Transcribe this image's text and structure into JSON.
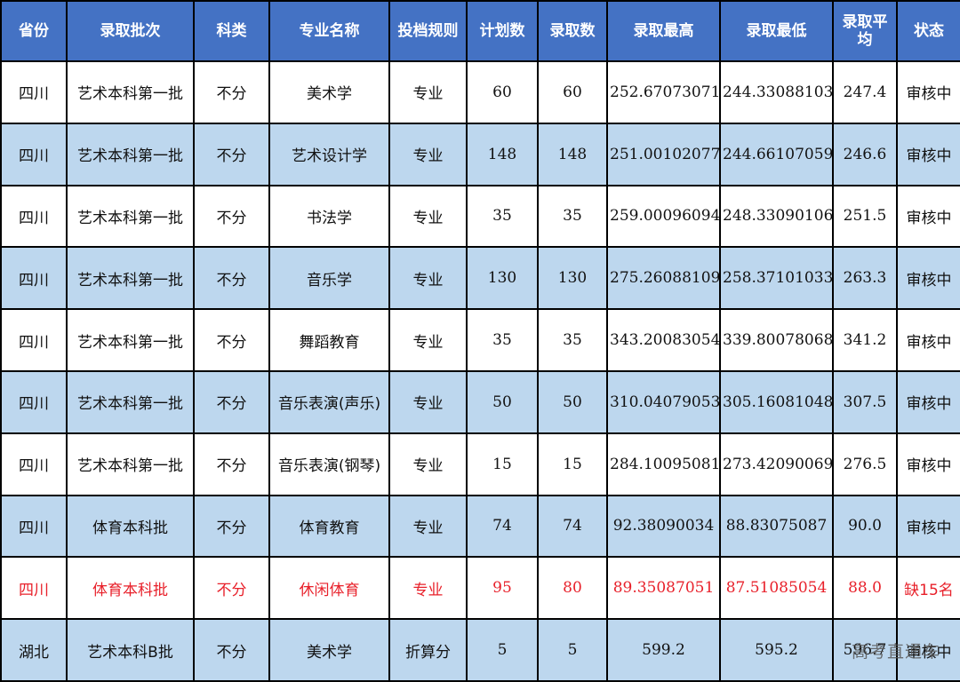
{
  "headers": {
    "province": "省份",
    "batch": "录取批次",
    "category": "科类",
    "major": "专业名称",
    "rule": "投档规则",
    "plan": "计划数",
    "admitted": "录取数",
    "max": "录取最高",
    "min": "录取最低",
    "avg": "录取平均",
    "status": "状态"
  },
  "rows": [
    {
      "province": "四川",
      "batch": "艺术本科第一批",
      "category": "不分",
      "major": "美术学",
      "rule": "专业",
      "plan": "60",
      "admitted": "60",
      "max": "252.67073071",
      "min": "244.33088103",
      "avg": "247.4",
      "status": "审核中"
    },
    {
      "province": "四川",
      "batch": "艺术本科第一批",
      "category": "不分",
      "major": "艺术设计学",
      "rule": "专业",
      "plan": "148",
      "admitted": "148",
      "max": "251.00102077",
      "min": "244.66107059",
      "avg": "246.6",
      "status": "审核中"
    },
    {
      "province": "四川",
      "batch": "艺术本科第一批",
      "category": "不分",
      "major": "书法学",
      "rule": "专业",
      "plan": "35",
      "admitted": "35",
      "max": "259.00096094",
      "min": "248.33090106",
      "avg": "251.5",
      "status": "审核中"
    },
    {
      "province": "四川",
      "batch": "艺术本科第一批",
      "category": "不分",
      "major": "音乐学",
      "rule": "专业",
      "plan": "130",
      "admitted": "130",
      "max": "275.26088109",
      "min": "258.37101033",
      "avg": "263.3",
      "status": "审核中"
    },
    {
      "province": "四川",
      "batch": "艺术本科第一批",
      "category": "不分",
      "major": "舞蹈教育",
      "rule": "专业",
      "plan": "35",
      "admitted": "35",
      "max": "343.20083054",
      "min": "339.80078068",
      "avg": "341.2",
      "status": "审核中"
    },
    {
      "province": "四川",
      "batch": "艺术本科第一批",
      "category": "不分",
      "major": "音乐表演(声乐)",
      "rule": "专业",
      "plan": "50",
      "admitted": "50",
      "max": "310.04079053",
      "min": "305.16081048",
      "avg": "307.5",
      "status": "审核中"
    },
    {
      "province": "四川",
      "batch": "艺术本科第一批",
      "category": "不分",
      "major": "音乐表演(钢琴)",
      "rule": "专业",
      "plan": "15",
      "admitted": "15",
      "max": "284.10095081",
      "min": "273.42090069",
      "avg": "276.5",
      "status": "审核中"
    },
    {
      "province": "四川",
      "batch": "体育本科批",
      "category": "不分",
      "major": "体育教育",
      "rule": "专业",
      "plan": "74",
      "admitted": "74",
      "max": "92.38090034",
      "min": "88.83075087",
      "avg": "90.0",
      "status": "审核中"
    },
    {
      "province": "四川",
      "batch": "体育本科批",
      "category": "不分",
      "major": "休闲体育",
      "rule": "专业",
      "plan": "95",
      "admitted": "80",
      "max": "89.35087051",
      "min": "87.51085054",
      "avg": "88.0",
      "status": "缺15名"
    },
    {
      "province": "湖北",
      "batch": "艺术本科B批",
      "category": "不分",
      "major": "美术学",
      "rule": "折算分",
      "plan": "5",
      "admitted": "5",
      "max": "599.2",
      "min": "595.2",
      "avg": "596.7",
      "status": "审核中"
    }
  ],
  "watermark": "高考直通车",
  "colors": {
    "header_bg": "#4472c4",
    "header_text": "#ffffff",
    "stripe_bg": "#bdd7ee",
    "alert_text": "#e8202a",
    "border": "#000000"
  }
}
